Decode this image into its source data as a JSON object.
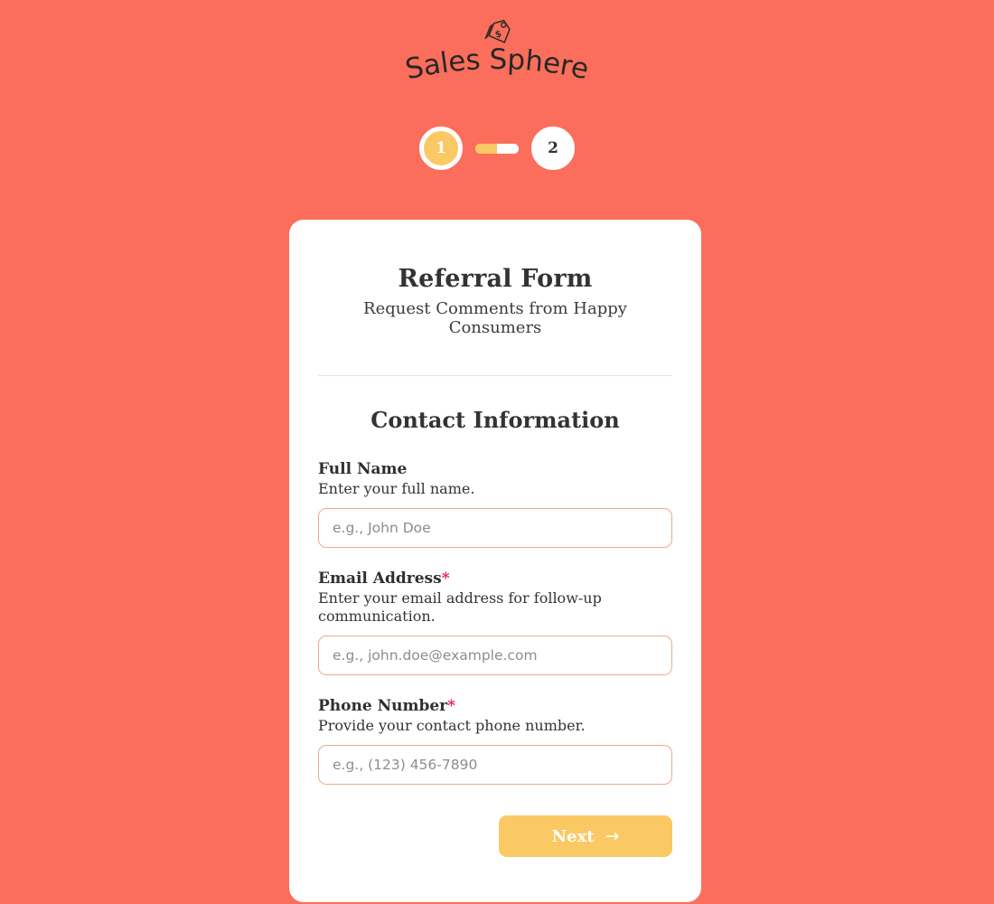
{
  "brand": {
    "name": "Sales Sphere",
    "icon": "price-tag-icon"
  },
  "stepper": {
    "steps": [
      {
        "label": "1",
        "state": "active"
      },
      {
        "label": "2",
        "state": "inactive"
      }
    ],
    "progress_percent": 50,
    "active_color": "#fbc963",
    "inactive_color": "#ffffff"
  },
  "card": {
    "title": "Referral Form",
    "subtitle": "Request Comments from Happy Consumers",
    "section_title": "Contact Information",
    "fields": [
      {
        "label": "Full Name",
        "required": false,
        "description": "Enter your full name.",
        "placeholder": "e.g., John Doe",
        "value": ""
      },
      {
        "label": "Email Address",
        "required": true,
        "description": "Enter your email address for follow-up communication.",
        "placeholder": "e.g., john.doe@example.com",
        "value": ""
      },
      {
        "label": "Phone Number",
        "required": true,
        "description": "Provide your contact phone number.",
        "placeholder": "e.g., (123) 456-7890",
        "value": ""
      }
    ],
    "next_label": "Next",
    "next_arrow": "→"
  },
  "colors": {
    "background": "#fb6e5c",
    "accent": "#fbc963",
    "input_border": "#f0a98e",
    "required_star": "#e8176b",
    "card_background": "#ffffff"
  }
}
